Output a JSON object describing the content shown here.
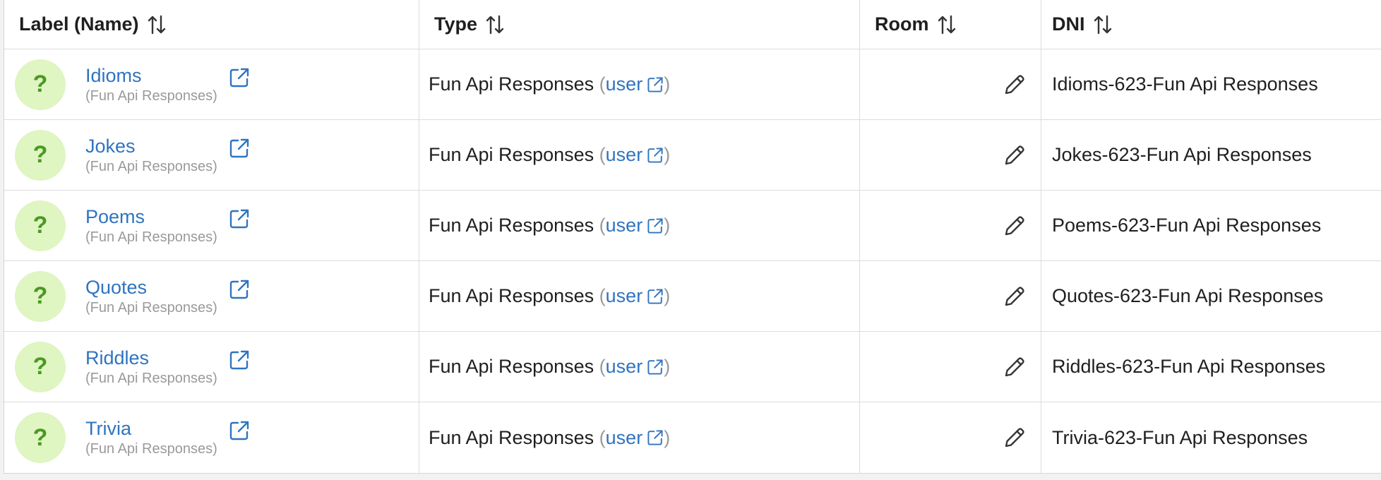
{
  "table": {
    "headers": {
      "label": "Label (Name)",
      "type": "Type",
      "room": "Room",
      "dni": "DNI"
    },
    "rows": [
      {
        "name": "Idioms",
        "sub": "(Fun Api Responses)",
        "avatar": "?",
        "type": "Fun Api Responses",
        "type_link": "user",
        "paren_open": "(",
        "paren_close": ")",
        "dni": "Idioms-623-Fun Api Responses"
      },
      {
        "name": "Jokes",
        "sub": "(Fun Api Responses)",
        "avatar": "?",
        "type": "Fun Api Responses",
        "type_link": "user",
        "paren_open": "(",
        "paren_close": ")",
        "dni": "Jokes-623-Fun Api Responses"
      },
      {
        "name": "Poems",
        "sub": "(Fun Api Responses)",
        "avatar": "?",
        "type": "Fun Api Responses",
        "type_link": "user",
        "paren_open": "(",
        "paren_close": ")",
        "dni": "Poems-623-Fun Api Responses"
      },
      {
        "name": "Quotes",
        "sub": "(Fun Api Responses)",
        "avatar": "?",
        "type": "Fun Api Responses",
        "type_link": "user",
        "paren_open": "(",
        "paren_close": ")",
        "dni": "Quotes-623-Fun Api Responses"
      },
      {
        "name": "Riddles",
        "sub": "(Fun Api Responses)",
        "avatar": "?",
        "type": "Fun Api Responses",
        "type_link": "user",
        "paren_open": "(",
        "paren_close": ")",
        "dni": "Riddles-623-Fun Api Responses"
      },
      {
        "name": "Trivia",
        "sub": "(Fun Api Responses)",
        "avatar": "?",
        "type": "Fun Api Responses",
        "type_link": "user",
        "paren_open": "(",
        "paren_close": ")",
        "dni": "Trivia-623-Fun Api Responses"
      }
    ]
  },
  "icons": {
    "sort": "sort-arrows-icon",
    "external": "external-link-icon",
    "edit": "pencil-icon",
    "avatar": "question-mark-avatar"
  },
  "colors": {
    "link": "#2f74c0",
    "muted": "#9a9a9a",
    "avatar_bg": "#dff5c2",
    "avatar_fg": "#4a9a22",
    "border": "#dcdcdc"
  }
}
